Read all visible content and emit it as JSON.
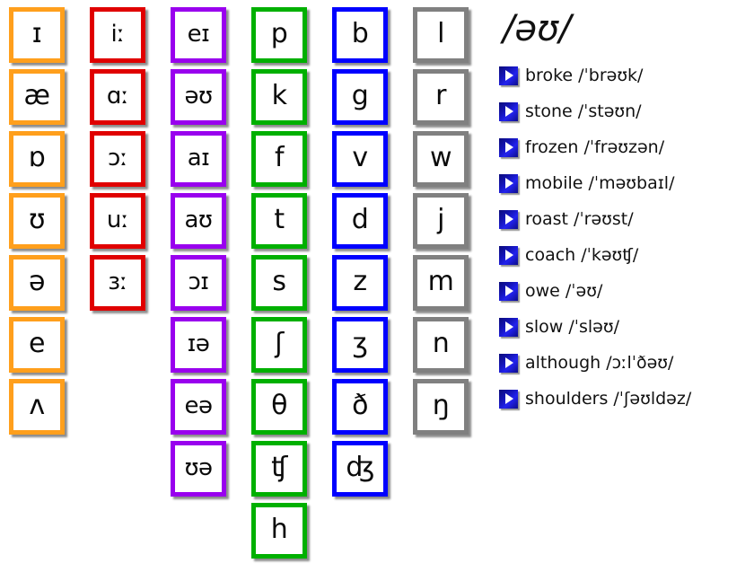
{
  "page": {
    "kind": "ipa-phonemic-chart",
    "background": "#ffffff"
  },
  "colors": {
    "short_vowels": "#FF9F1C",
    "long_vowels": "#E00000",
    "diphthongs": "#9900EE",
    "voiceless_consonants": "#00B000",
    "voiced_consonants": "#0000FF",
    "other_consonants": "#808080",
    "play_button": "#1414B4",
    "text": "#111111"
  },
  "chart": {
    "columns": [
      {
        "name": "short-vowels",
        "color_key": "short_vowels",
        "color": "#FF9F1C",
        "tiles": [
          {
            "symbol": "ɪ"
          },
          {
            "symbol": "æ"
          },
          {
            "symbol": "ɒ"
          },
          {
            "symbol": "ʊ"
          },
          {
            "symbol": "ə"
          },
          {
            "symbol": "e"
          },
          {
            "symbol": "ʌ"
          }
        ]
      },
      {
        "name": "long-vowels",
        "color_key": "long_vowels",
        "color": "#E00000",
        "tiles": [
          {
            "symbol": "iː"
          },
          {
            "symbol": "ɑː"
          },
          {
            "symbol": "ɔː"
          },
          {
            "symbol": "uː"
          },
          {
            "symbol": "ɜː"
          }
        ]
      },
      {
        "name": "diphthongs",
        "color_key": "diphthongs",
        "color": "#9900EE",
        "tiles": [
          {
            "symbol": "eɪ"
          },
          {
            "symbol": "əʊ"
          },
          {
            "symbol": "aɪ"
          },
          {
            "symbol": "aʊ"
          },
          {
            "symbol": "ɔɪ"
          },
          {
            "symbol": "ɪə"
          },
          {
            "symbol": "eə"
          },
          {
            "symbol": "ʊə"
          }
        ]
      },
      {
        "name": "voiceless-consonants",
        "color_key": "voiceless_consonants",
        "color": "#00B000",
        "tiles": [
          {
            "symbol": "p"
          },
          {
            "symbol": "k"
          },
          {
            "symbol": "f"
          },
          {
            "symbol": "t"
          },
          {
            "symbol": "s"
          },
          {
            "symbol": "ʃ"
          },
          {
            "symbol": "θ"
          },
          {
            "symbol": "ʧ"
          },
          {
            "symbol": "h"
          }
        ]
      },
      {
        "name": "voiced-consonants",
        "color_key": "voiced_consonants",
        "color": "#0000FF",
        "tiles": [
          {
            "symbol": "b"
          },
          {
            "symbol": "g"
          },
          {
            "symbol": "v"
          },
          {
            "symbol": "d"
          },
          {
            "symbol": "z"
          },
          {
            "symbol": "ʒ"
          },
          {
            "symbol": "ð"
          },
          {
            "symbol": "ʤ"
          }
        ]
      },
      {
        "name": "other-consonants",
        "color_key": "other_consonants",
        "color": "#808080",
        "tiles": [
          {
            "symbol": "l"
          },
          {
            "symbol": "r"
          },
          {
            "symbol": "w"
          },
          {
            "symbol": "j"
          },
          {
            "symbol": "m"
          },
          {
            "symbol": "n"
          },
          {
            "symbol": "ŋ"
          }
        ]
      }
    ]
  },
  "panel": {
    "title": "/əʊ/",
    "play_icon_name": "play-icon",
    "words": [
      {
        "word": "broke",
        "transcription": "/ˈbrəʊk/",
        "text": "broke /ˈbrəʊk/"
      },
      {
        "word": "stone",
        "transcription": "/ˈstəʊn/",
        "text": "stone /ˈstəʊn/"
      },
      {
        "word": "frozen",
        "transcription": "/ˈfrəʊzən/",
        "text": "frozen /ˈfrəʊzən/"
      },
      {
        "word": "mobile",
        "transcription": "/ˈməʊbaɪl/",
        "text": "mobile /ˈməʊbaɪl/"
      },
      {
        "word": "roast",
        "transcription": "/ˈrəʊst/",
        "text": "roast /ˈrəʊst/"
      },
      {
        "word": "coach",
        "transcription": "/ˈkəʊʧ/",
        "text": "coach /ˈkəʊʧ/"
      },
      {
        "word": "owe",
        "transcription": "/ˈəʊ/",
        "text": "owe /ˈəʊ/"
      },
      {
        "word": "slow",
        "transcription": "/ˈsləʊ/",
        "text": "slow /ˈsləʊ/"
      },
      {
        "word": "although",
        "transcription": "/ɔːlˈðəʊ/",
        "text": "although /ɔːlˈðəʊ/"
      },
      {
        "word": "shoulders",
        "transcription": "/ˈʃəʊldəz/",
        "text": "shoulders /ˈʃəʊldəz/"
      }
    ]
  }
}
